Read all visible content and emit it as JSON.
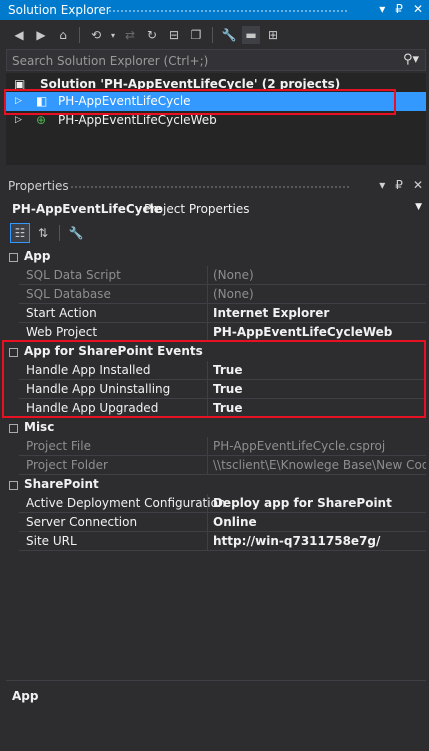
{
  "solution_explorer": {
    "title": "Solution Explorer",
    "window_btns": [
      "▾",
      "₽",
      "✕"
    ],
    "search_placeholder": "Search Solution Explorer (Ctrl+;)",
    "tree": [
      {
        "label": "Solution 'PH-AppEventLifeCycle' (2 projects)",
        "bold": true
      },
      {
        "label": "PH-AppEventLifeCycle",
        "selected": true
      },
      {
        "label": "PH-AppEventLifeCycleWeb"
      }
    ]
  },
  "properties": {
    "title": "Properties",
    "window_btns": [
      "▾",
      "₽",
      "✕"
    ],
    "object_name": "PH-AppEventLifeCycle",
    "object_type": "Project Properties",
    "categories": [
      {
        "name": "App",
        "rows": [
          {
            "key": "SQL Data Script",
            "value": "(None)",
            "readonly": true
          },
          {
            "key": "SQL Database",
            "value": "(None)",
            "readonly": true
          },
          {
            "key": "Start Action",
            "value": "Internet Explorer"
          },
          {
            "key": "Web Project",
            "value": "PH-AppEventLifeCycleWeb"
          }
        ]
      },
      {
        "name": "App for SharePoint Events",
        "rows": [
          {
            "key": "Handle App Installed",
            "value": "True"
          },
          {
            "key": "Handle App Uninstalling",
            "value": "True"
          },
          {
            "key": "Handle App Upgraded",
            "value": "True"
          }
        ]
      },
      {
        "name": "Misc",
        "rows": [
          {
            "key": "Project File",
            "value": "PH-AppEventLifeCycle.csproj",
            "readonly": true
          },
          {
            "key": "Project Folder",
            "value": "\\\\tsclient\\E\\Knowlege Base\\New Code\\F",
            "readonly": true
          }
        ]
      },
      {
        "name": "SharePoint",
        "rows": [
          {
            "key": "Active Deployment Configuration",
            "value": "Deploy app for SharePoint"
          },
          {
            "key": "Server Connection",
            "value": "Online"
          },
          {
            "key": "Site URL",
            "value": "http://win-q7311758e7g/"
          }
        ]
      }
    ],
    "description": "App"
  },
  "colors": {
    "accent": "#007acc",
    "selection": "#3399ff",
    "highlight_box": "#e81123",
    "background": "#2d2d30"
  }
}
